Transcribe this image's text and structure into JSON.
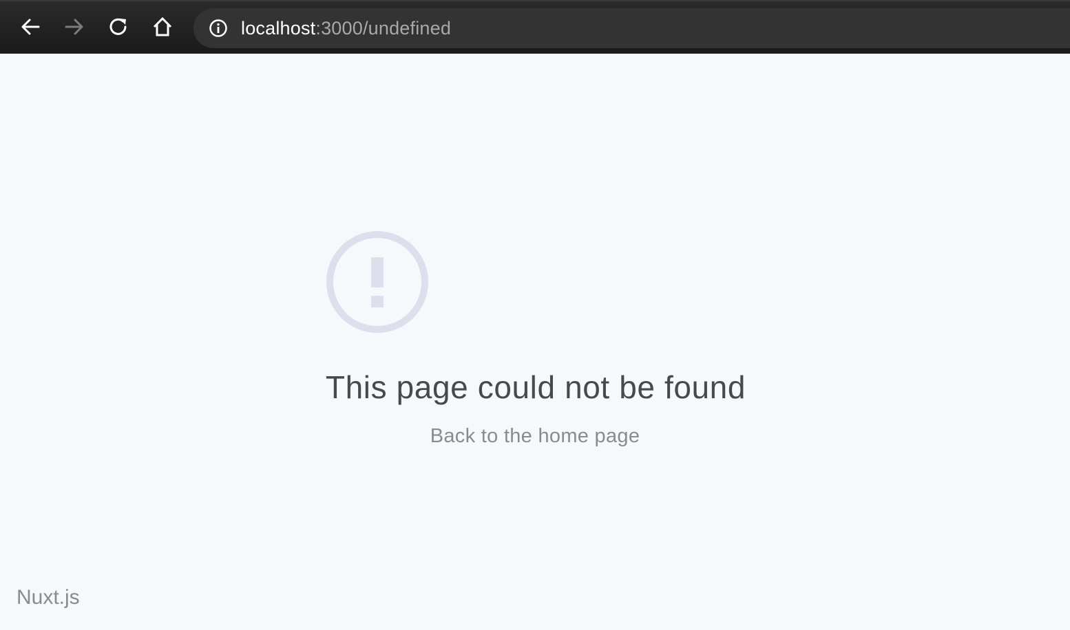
{
  "browser": {
    "url_host": "localhost",
    "url_rest": ":3000/undefined"
  },
  "page": {
    "title": "This page could not be found",
    "home_link": "Back to the home page",
    "brand": "Nuxt.js"
  },
  "colors": {
    "toolbar": "#1F1F1F",
    "address_bar": "#333333",
    "page_background": "#F7F8FB",
    "icon": "#DCE0EC",
    "title_text": "#47494E",
    "muted_text": "#8A8B90"
  }
}
